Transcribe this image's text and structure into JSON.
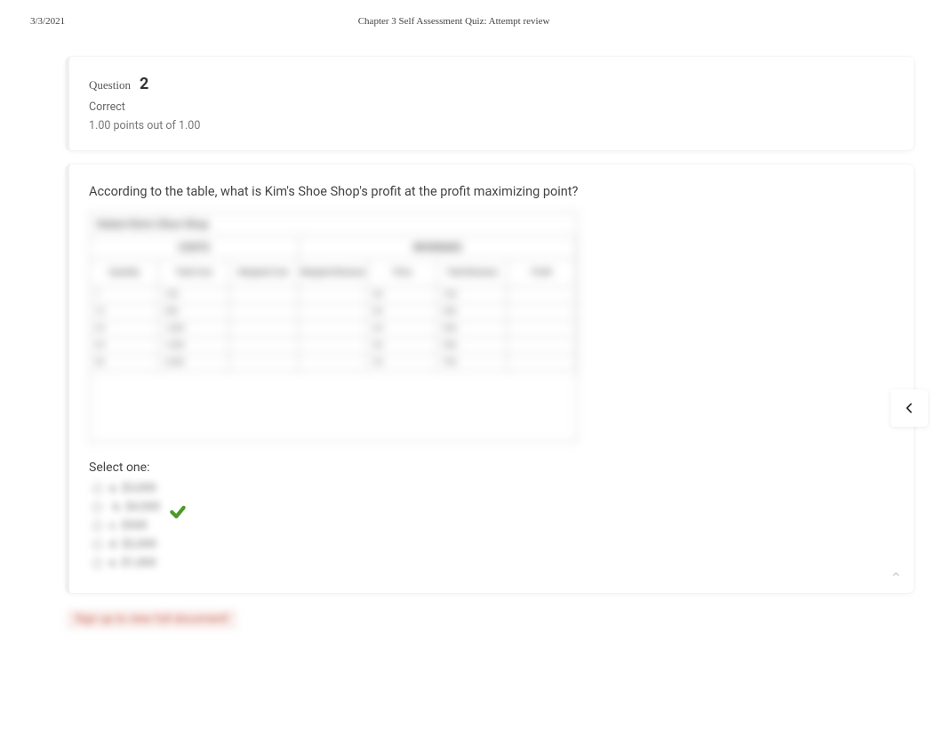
{
  "header": {
    "date": "3/3/2021",
    "title": "Chapter 3 Self Assessment Quiz: Attempt review"
  },
  "question": {
    "label": "Question",
    "number": "2",
    "status": "Correct",
    "points": "1.00 points out of 1.00"
  },
  "prompt": "According to the table, what is Kim's Shoe Shop's profit at the profit maximizing point?",
  "table": {
    "title": "Kalani Kim's Shoe Shop",
    "group_headers": [
      "COSTS",
      "REVENUES"
    ],
    "sub_headers": [
      "Quantity",
      "Total Cost",
      "Marginal Cost",
      "Marginal Revenue",
      "Price",
      "Total Revenue",
      "Profit"
    ]
  },
  "select_one": "Select one:",
  "options": [
    "a. $3,000",
    "b. $4,500",
    "c. $500",
    "d. $2,000",
    "e. $1,000"
  ],
  "signup": "Sign up to view full document!",
  "icons": {
    "chevron_left": "chevron-left",
    "caret_up": "caret-up",
    "checkmark": "check"
  }
}
